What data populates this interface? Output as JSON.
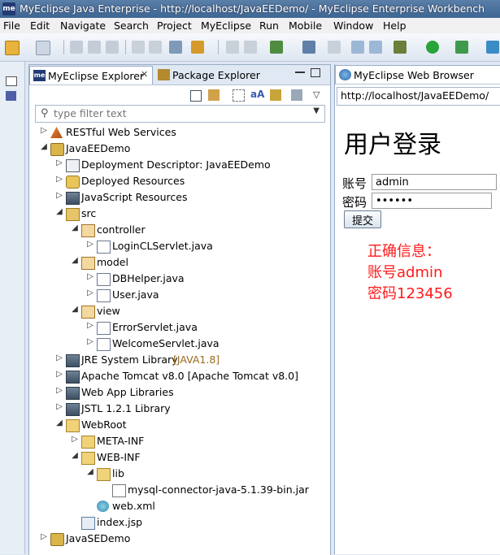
{
  "window": {
    "title": "MyEclipse Java Enterprise - http://localhost/JavaEEDemo/ - MyEclipse Enterprise Workbench",
    "app_badge": "me"
  },
  "menu": [
    "File",
    "Edit",
    "Navigate",
    "Search",
    "Project",
    "MyEclipse",
    "Run",
    "Mobile",
    "Window",
    "Help"
  ],
  "explorer": {
    "tab_label": "MyEclipse Explorer",
    "tab_badge": "me",
    "tab2_label": "Package Explorer",
    "close_glyph": "✕",
    "filter_placeholder": "type filter text",
    "tree": [
      {
        "label": "RESTful Web Services",
        "twisty": "▷",
        "icon": "rest-icon"
      },
      {
        "label": "JavaEEDemo",
        "twisty": "◢",
        "icon": "project-icon"
      },
      {
        "label": "Deployment Descriptor: JavaEEDemo",
        "twisty": "▷",
        "icon": "descriptor-icon"
      },
      {
        "label": "Deployed Resources",
        "twisty": "▷",
        "icon": "deployed-icon"
      },
      {
        "label": "JavaScript Resources",
        "twisty": "▷",
        "icon": "library-icon"
      },
      {
        "label": "src",
        "twisty": "◢",
        "icon": "source-folder-icon"
      },
      {
        "label": "controller",
        "twisty": "◢",
        "icon": "package-icon"
      },
      {
        "label": "LoginCLServlet.java",
        "twisty": "▷",
        "icon": "java-file-icon"
      },
      {
        "label": "model",
        "twisty": "◢",
        "icon": "package-icon"
      },
      {
        "label": "DBHelper.java",
        "twisty": "▷",
        "icon": "java-file-icon"
      },
      {
        "label": "User.java",
        "twisty": "▷",
        "icon": "java-file-icon"
      },
      {
        "label": "view",
        "twisty": "◢",
        "icon": "package-icon"
      },
      {
        "label": "ErrorServlet.java",
        "twisty": "▷",
        "icon": "java-file-icon"
      },
      {
        "label": "WelcomeServlet.java",
        "twisty": "▷",
        "icon": "java-file-icon"
      },
      {
        "label": "JRE System Library",
        "decoration": "[JAVA1.8]",
        "twisty": "▷",
        "icon": "library-icon"
      },
      {
        "label": "Apache Tomcat v8.0 [Apache Tomcat v8.0]",
        "twisty": "▷",
        "icon": "library-icon"
      },
      {
        "label": "Web App Libraries",
        "twisty": "▷",
        "icon": "library-icon"
      },
      {
        "label": "JSTL 1.2.1 Library",
        "twisty": "▷",
        "icon": "library-icon"
      },
      {
        "label": "WebRoot",
        "twisty": "◢",
        "icon": "folder-icon"
      },
      {
        "label": "META-INF",
        "twisty": "▷",
        "icon": "folder-icon"
      },
      {
        "label": "WEB-INF",
        "twisty": "◢",
        "icon": "folder-icon"
      },
      {
        "label": "lib",
        "twisty": "◢",
        "icon": "folder-icon"
      },
      {
        "label": "mysql-connector-java-5.1.39-bin.jar",
        "twisty": "",
        "icon": "jar-icon"
      },
      {
        "label": "web.xml",
        "twisty": "",
        "icon": "xml-icon"
      },
      {
        "label": "index.jsp",
        "twisty": "",
        "icon": "jsp-icon"
      },
      {
        "label": "JavaSEDemo",
        "twisty": "▷",
        "icon": "project-icon"
      }
    ]
  },
  "browser": {
    "tab_label": "MyEclipse Web Browser",
    "url": "http://localhost/JavaEEDemo/",
    "page": {
      "heading": "用户登录",
      "account_label": "账号",
      "account_value": "admin",
      "password_label": "密码",
      "password_value": "123456",
      "submit_label": "提交"
    },
    "note_lines": [
      "正确信息：",
      "账号admin",
      "密码123456"
    ]
  },
  "colors": {
    "note": "#ff1a1a",
    "decoration": "#9a6b1d",
    "accent": "#3d6694"
  }
}
